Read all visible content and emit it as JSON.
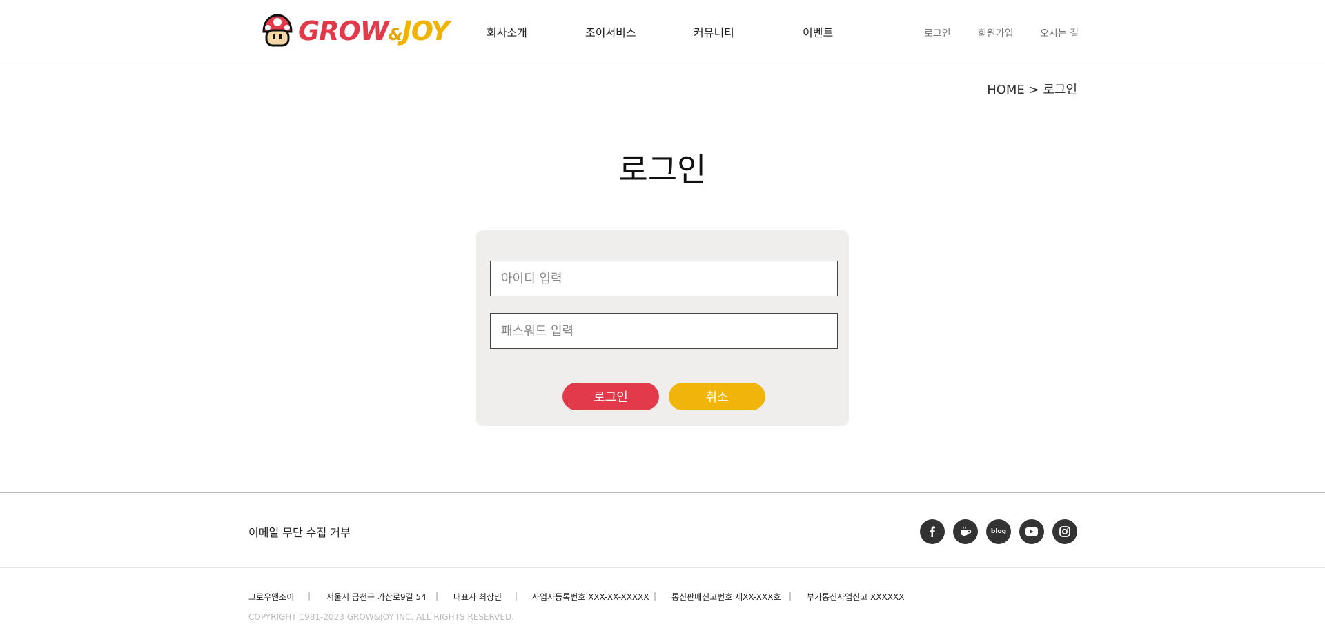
{
  "header": {
    "logo": {
      "brand_grow": "GROW",
      "brand_amp": "&",
      "brand_joy": "JOY"
    },
    "nav": [
      "회사소개",
      "조이서비스",
      "커뮤니티",
      "이벤트"
    ],
    "util": [
      "로그인",
      "회원가입",
      "오시는 길"
    ]
  },
  "breadcrumb": "HOME > 로그인",
  "title": "로그인",
  "form": {
    "id_placeholder": "아이디 입력",
    "pw_placeholder": "패스워드 입력",
    "login_label": "로그인",
    "cancel_label": "취소"
  },
  "footer": {
    "policy": "이메일 무단 수집 거부",
    "social": [
      "facebook-icon",
      "cafe-icon",
      "blog-icon",
      "youtube-icon",
      "instagram-icon"
    ],
    "blog_text": "blog",
    "info": [
      "그로우앤조이",
      "서울시 금천구 가산로9길 54",
      "대표자 최상민",
      "사업자등록번호 XXX-XX-XXXXX",
      "통신판매신고번호 제XX-XXX호",
      "부가통신사업신고 XXXXXX"
    ],
    "separator": "|",
    "copyright": "COPYRIGHT 1981-2023 GROW&JOY INC. ALL RIGHTS RESERVED."
  },
  "colors": {
    "accent_red": "#e23a4a",
    "accent_yellow": "#f0b40a",
    "box_bg": "#efeeec",
    "social_bg": "#333333"
  }
}
